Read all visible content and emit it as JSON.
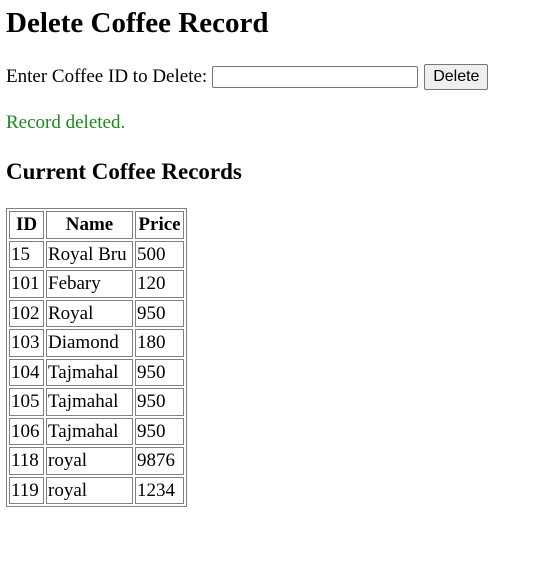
{
  "page": {
    "title": "Delete Coffee Record"
  },
  "form": {
    "label": "Enter Coffee ID to Delete:",
    "input_value": "",
    "input_placeholder": "",
    "button_label": "Delete"
  },
  "status": {
    "message": "Record deleted.",
    "color": "#1a8a1a"
  },
  "records": {
    "heading": "Current Coffee Records",
    "columns": [
      "ID",
      "Name",
      "Price"
    ],
    "rows": [
      [
        "15",
        "Royal Bru",
        "500"
      ],
      [
        "101",
        "Febary",
        "120"
      ],
      [
        "102",
        "Royal",
        "950"
      ],
      [
        "103",
        "Diamond",
        "180"
      ],
      [
        "104",
        "Tajmahal",
        "950"
      ],
      [
        "105",
        "Tajmahal",
        "950"
      ],
      [
        "106",
        "Tajmahal",
        "950"
      ],
      [
        "118",
        "royal",
        "9876"
      ],
      [
        "119",
        "royal",
        "1234"
      ]
    ]
  }
}
